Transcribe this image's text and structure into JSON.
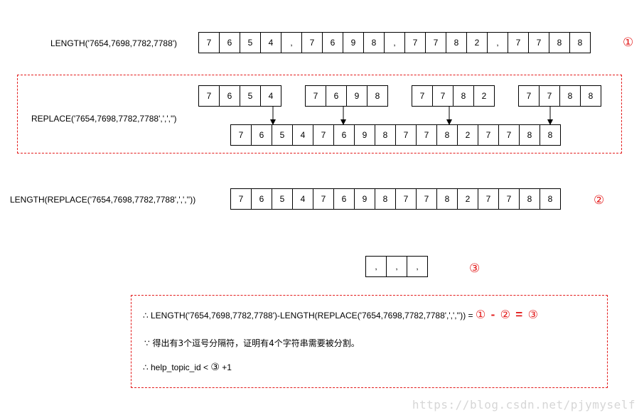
{
  "row1": {
    "label": "LENGTH('7654,7698,7782,7788')",
    "cells": [
      "7",
      "6",
      "5",
      "4",
      ",",
      "7",
      "6",
      "9",
      "8",
      ",",
      "7",
      "7",
      "8",
      "2",
      ",",
      "7",
      "7",
      "8",
      "8"
    ],
    "marker": "①"
  },
  "section2": {
    "label": "REPLACE('7654,7698,7782,7788',',','')",
    "groups": [
      [
        "7",
        "6",
        "5",
        "4"
      ],
      [
        "7",
        "6",
        "9",
        "8"
      ],
      [
        "7",
        "7",
        "8",
        "2"
      ],
      [
        "7",
        "7",
        "8",
        "8"
      ]
    ],
    "merged": [
      "7",
      "6",
      "5",
      "4",
      "7",
      "6",
      "9",
      "8",
      "7",
      "7",
      "8",
      "2",
      "7",
      "7",
      "8",
      "8"
    ]
  },
  "row3": {
    "label": "LENGTH(REPLACE('7654,7698,7782,7788',',',''))",
    "cells": [
      "7",
      "6",
      "5",
      "4",
      "7",
      "6",
      "9",
      "8",
      "7",
      "7",
      "8",
      "2",
      "7",
      "7",
      "8",
      "8"
    ],
    "marker": "②"
  },
  "row4": {
    "cells": [
      ",",
      ",",
      ","
    ],
    "marker": "③"
  },
  "formula": {
    "line1_prefix": "∴ LENGTH('7654,7698,7782,7788')-LENGTH(REPLACE('7654,7698,7782,7788',',','')) =",
    "c1": "①",
    "minus": "-",
    "c2": "②",
    "equals": "=",
    "c3": "③",
    "line2": "∵ 得出有3个逗号分隔符，证明有4个字符串需要被分割。",
    "line3_prefix": "∴ help_topic_id  <",
    "line3_circ": "③",
    "line3_suffix": "+1"
  },
  "watermark": "https://blog.csdn.net/pjymyself"
}
